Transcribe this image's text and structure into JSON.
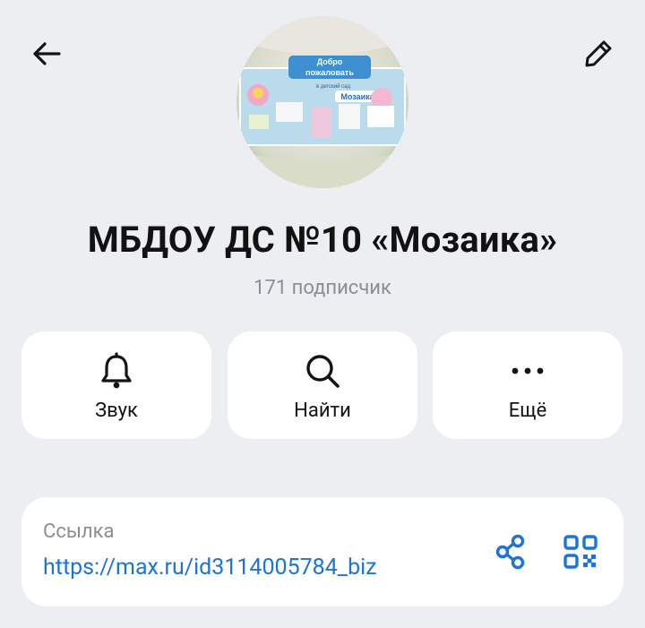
{
  "header": {
    "back_icon": "arrow-left-icon",
    "edit_icon": "pencil-icon"
  },
  "avatar_sign": {
    "line1": "Добро",
    "line2": "пожаловать",
    "small": "в детский сад",
    "name": "Мозаика"
  },
  "channel": {
    "title": "МБДОУ ДС №10 «Мозаика»",
    "subscribers": "171 подписчик"
  },
  "actions": [
    {
      "label": "Звук",
      "icon": "bell-icon"
    },
    {
      "label": "Найти",
      "icon": "search-icon"
    },
    {
      "label": "Ещё",
      "icon": "more-dots-icon"
    }
  ],
  "link": {
    "caption": "Ссылка",
    "url": "https://max.ru/id3114005784_biz",
    "share_icon": "share-icon",
    "qr_icon": "qr-code-icon"
  },
  "colors": {
    "background": "#eceef2",
    "card": "#ffffff",
    "accent": "#1d73d8",
    "muted": "#8a8d94"
  }
}
